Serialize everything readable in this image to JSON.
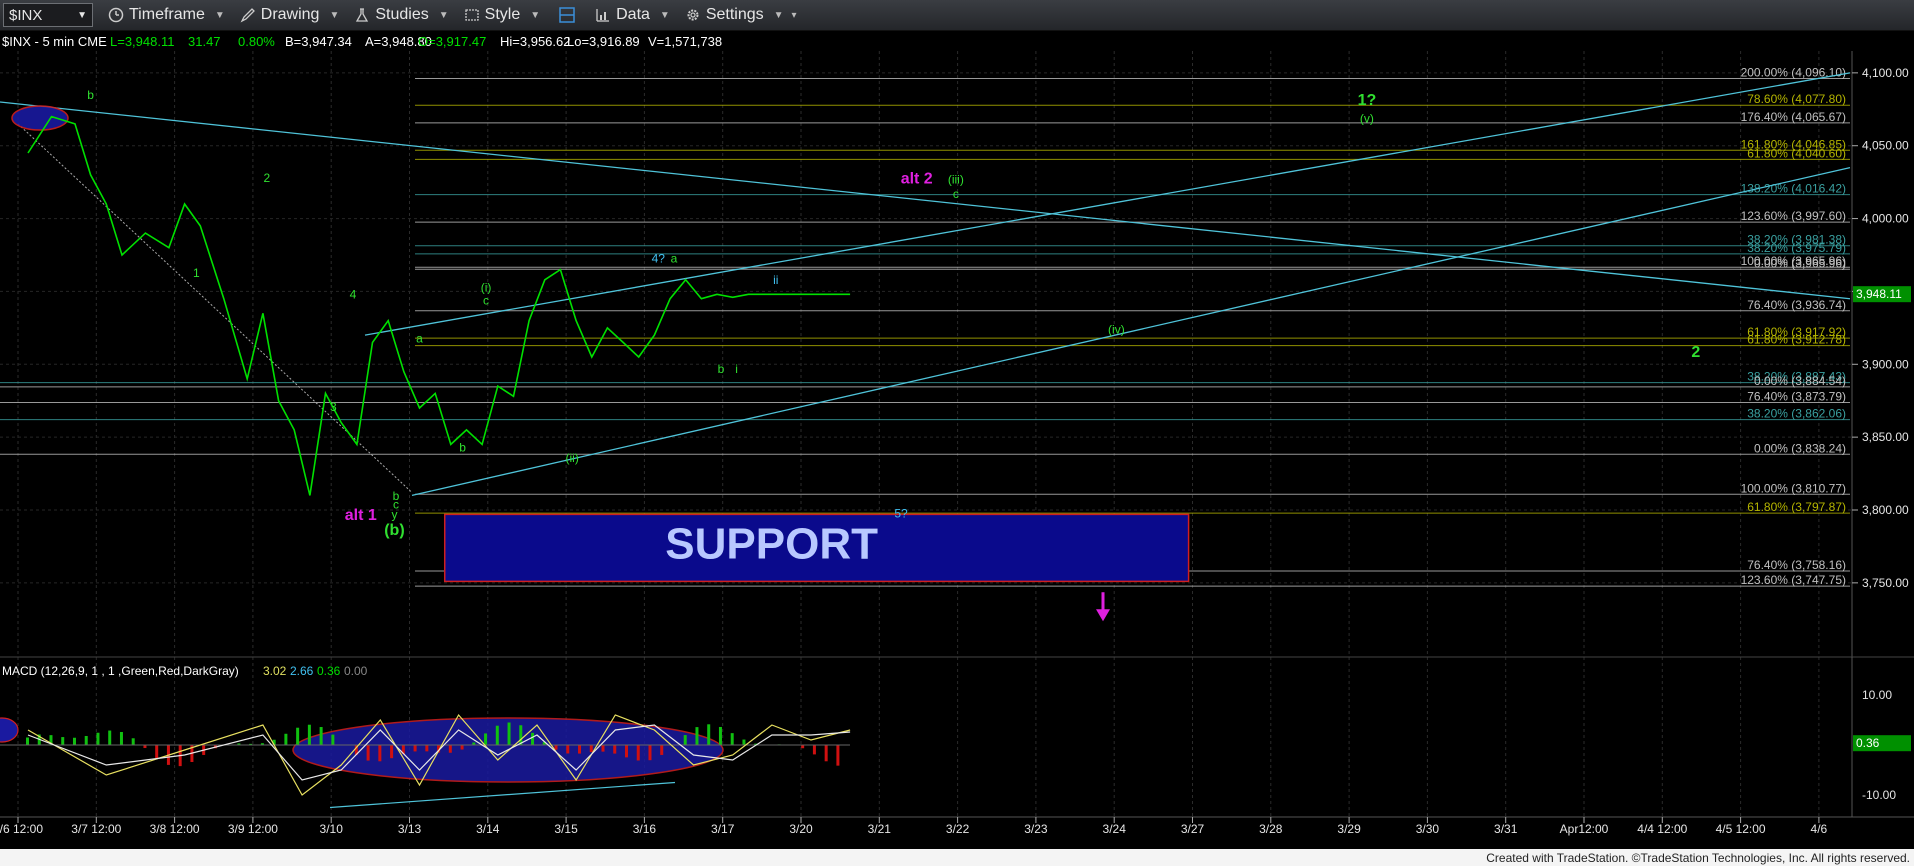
{
  "toolbar": {
    "symbol": "$INX",
    "timeframe": "Timeframe",
    "drawing": "Drawing",
    "studies": "Studies",
    "style": "Style",
    "data": "Data",
    "settings": "Settings"
  },
  "header": {
    "symbol_info": "$INX - 5 min  CME",
    "last": "L=3,948.11",
    "net": "31.47",
    "pct": "0.80%",
    "bid": "B=3,947.34",
    "ask": "A=3,948.80",
    "open": "O=3,917.47",
    "high": "Hi=3,956.62",
    "low": "Lo=3,916.89",
    "volume": "V=1,571,738"
  },
  "colors": {
    "price": "#00e000",
    "grid": "#2a2a2a",
    "fib_gray": "#c0c0c0",
    "fib_olive": "#b5b500",
    "fib_teal": "#3aa0a0",
    "trendline": "#4fc3d9",
    "magenta": "#e020e0",
    "support_fill": "#0a0a8c",
    "support_border": "#d02020",
    "last_price_bg": "#009000"
  },
  "chart_data": [
    {
      "type": "line",
      "title": "",
      "xlabel": "",
      "ylabel": "",
      "x_ticks": [
        "3/6 12:00",
        "3/7 12:00",
        "3/8 12:00",
        "3/9 12:00",
        "3/10",
        "3/13",
        "3/14",
        "3/15",
        "3/16",
        "3/17",
        "3/20",
        "3/21",
        "3/22",
        "3/23",
        "3/24",
        "3/27",
        "3/28",
        "3/29",
        "3/30",
        "3/31",
        "Apr12:00",
        "4/4 12:00",
        "4/5 12:00",
        "4/6"
      ],
      "ylim": [
        3730,
        4115
      ],
      "y_ticks": [
        3750,
        3800,
        3850,
        3900,
        3950,
        4000,
        4050,
        4100
      ],
      "y_tick_labels": [
        "3,750.00",
        "3,800.00",
        "3,850.00",
        "3,900.00",
        "3,950.00",
        "4,000.00",
        "4,050.00",
        "4,100.00"
      ],
      "last_price_label": "3,948.11",
      "series": [
        {
          "x": [
            0,
            0.3,
            0.6,
            0.8,
            1.0,
            1.2,
            1.5,
            1.8,
            2.0,
            2.2,
            2.5,
            2.8,
            3.0,
            3.2,
            3.4,
            3.6,
            3.8,
            4.0,
            4.2,
            4.4,
            4.6,
            4.8,
            5.0,
            5.2,
            5.4,
            5.6,
            5.8,
            6.0,
            6.2,
            6.4,
            6.6,
            6.8,
            7.0,
            7.2,
            7.4,
            7.6,
            7.8,
            8.0,
            8.2,
            8.4,
            8.6,
            8.8,
            9.0,
            9.2,
            9.4,
            9.6,
            9.8,
            10.0,
            10.2,
            10.4,
            10.5
          ],
          "y": [
            4045,
            4070,
            4065,
            4030,
            4010,
            3975,
            3990,
            3980,
            4010,
            3995,
            3945,
            3890,
            3935,
            3875,
            3855,
            3810,
            3880,
            3860,
            3845,
            3915,
            3930,
            3895,
            3870,
            3880,
            3845,
            3855,
            3845,
            3885,
            3878,
            3930,
            3958,
            3965,
            3930,
            3905,
            3925,
            3915,
            3905,
            3920,
            3945,
            3958,
            3945,
            3948,
            3946,
            3948,
            3948,
            3948,
            3948,
            3948,
            3948,
            3948,
            3948
          ]
        }
      ],
      "fib_levels": [
        {
          "label": "200.00% (4,096.10)",
          "value": 4096.1,
          "color": "gray"
        },
        {
          "label": "78.60% (4,077.80)",
          "value": 4077.8,
          "color": "olive"
        },
        {
          "label": "176.40% (4,065.67)",
          "value": 4065.67,
          "color": "gray"
        },
        {
          "label": "161.80% (4,046.85)",
          "value": 4046.85,
          "color": "olive"
        },
        {
          "label": "61.80% (4,040.60)",
          "value": 4040.6,
          "color": "olive"
        },
        {
          "label": "138.20% (4,016.42)",
          "value": 4016.42,
          "color": "teal"
        },
        {
          "label": "123.60% (3,997.60)",
          "value": 3997.6,
          "color": "gray"
        },
        {
          "label": "38.20% (3,981.38)",
          "value": 3981.38,
          "color": "teal"
        },
        {
          "label": "38.20% (3,975.79)",
          "value": 3975.79,
          "color": "teal"
        },
        {
          "label": "100.00% (3,965.96)",
          "value": 3966.6,
          "color": "gray"
        },
        {
          "label": "0.00% (3,965.96)",
          "value": 3965.2,
          "color": "gray"
        },
        {
          "label": "76.40% (3,936.74)",
          "value": 3936.74,
          "color": "gray"
        },
        {
          "label": "61.80% (3,917.92)",
          "value": 3917.92,
          "color": "olive"
        },
        {
          "label": "61.80% (3,912.78)",
          "value": 3912.78,
          "color": "olive"
        },
        {
          "label": "38.20% (3,887.43)",
          "value": 3887.43,
          "color": "teal"
        },
        {
          "label": "0.00% (3,884.54)",
          "value": 3884.54,
          "color": "gray"
        },
        {
          "label": "76.40% (3,873.79)",
          "value": 3873.79,
          "color": "gray"
        },
        {
          "label": "38.20% (3,862.06)",
          "value": 3862.06,
          "color": "teal"
        },
        {
          "label": "0.00% (3,838.24)",
          "value": 3838.24,
          "color": "gray"
        },
        {
          "label": "100.00% (3,810.77)",
          "value": 3810.77,
          "color": "gray"
        },
        {
          "label": "61.80% (3,797.87)",
          "value": 3797.87,
          "color": "olive"
        },
        {
          "label": "76.40% (3,758.16)",
          "value": 3758.16,
          "color": "gray"
        },
        {
          "label": "123.60% (3,747.75)",
          "value": 3747.75,
          "color": "gray"
        }
      ],
      "annotations": [
        {
          "text": "b",
          "x": 0.8,
          "y": 4082,
          "color": "green"
        },
        {
          "text": "2",
          "x": 3.05,
          "y": 4025,
          "color": "green"
        },
        {
          "text": "1",
          "x": 2.15,
          "y": 3960,
          "color": "green"
        },
        {
          "text": "4",
          "x": 4.15,
          "y": 3945,
          "color": "green"
        },
        {
          "text": "3",
          "x": 3.9,
          "y": 3868,
          "color": "green"
        },
        {
          "text": "a",
          "x": 5.0,
          "y": 3915,
          "color": "green"
        },
        {
          "text": "b",
          "x": 5.55,
          "y": 3840,
          "color": "green"
        },
        {
          "text": "(i)",
          "x": 5.85,
          "y": 3950,
          "color": "green"
        },
        {
          "text": "c",
          "x": 5.85,
          "y": 3941,
          "color": "green"
        },
        {
          "text": "(ii)",
          "x": 6.95,
          "y": 3833,
          "color": "green"
        },
        {
          "text": "4?",
          "x": 8.05,
          "y": 3970,
          "color": "teal"
        },
        {
          "text": "a",
          "x": 8.25,
          "y": 3970,
          "color": "green"
        },
        {
          "text": "b",
          "x": 8.85,
          "y": 3894,
          "color": "green"
        },
        {
          "text": "i",
          "x": 9.05,
          "y": 3894,
          "color": "green"
        },
        {
          "text": "ii",
          "x": 9.55,
          "y": 3955,
          "color": "teal"
        },
        {
          "text": "b",
          "x": 4.7,
          "y": 3807,
          "color": "green"
        },
        {
          "text": "c",
          "x": 4.7,
          "y": 3801,
          "color": "green"
        },
        {
          "text": "y",
          "x": 4.68,
          "y": 3794,
          "color": "green"
        },
        {
          "text": "(b)",
          "x": 4.68,
          "y": 3783,
          "color": "green"
        },
        {
          "text": "alt 1",
          "x": 4.25,
          "y": 3793,
          "color": "magenta"
        },
        {
          "text": "5?",
          "x": 11.15,
          "y": 3795,
          "color": "teal"
        },
        {
          "text": "alt 2",
          "x": 11.35,
          "y": 4024,
          "color": "magenta"
        },
        {
          "text": "(iii)",
          "x": 11.85,
          "y": 4024,
          "color": "green"
        },
        {
          "text": "c",
          "x": 11.85,
          "y": 4014,
          "color": "green"
        },
        {
          "text": "(iv)",
          "x": 13.9,
          "y": 3921,
          "color": "green"
        },
        {
          "text": "1?",
          "x": 17.1,
          "y": 4078,
          "color": "green"
        },
        {
          "text": "(v)",
          "x": 17.1,
          "y": 4066,
          "color": "green"
        },
        {
          "text": "2",
          "x": 21.3,
          "y": 3905,
          "color": "green"
        }
      ],
      "support_box": {
        "label": "SUPPORT",
        "x0": 5.45,
        "x1": 14.95,
        "y0": 3751,
        "y1": 3797
      }
    },
    {
      "type": "line",
      "title": "MACD (12,26,9, 1 , 1 ,Green,Red,DarkGray)",
      "values_shown": [
        "3.02",
        "2.66",
        "0.36",
        "0.00"
      ],
      "ylim": [
        -14,
        16
      ],
      "y_ticks": [
        10,
        -10
      ],
      "y_tick_labels": [
        "10.00",
        "-10.00"
      ],
      "last_value_label": "0.36",
      "series": [
        {
          "name": "MACD",
          "x": [
            0,
            1,
            2,
            3,
            3.5,
            4,
            4.5,
            5,
            5.5,
            6,
            6.5,
            7,
            7.5,
            8,
            8.5,
            9,
            9.5,
            10,
            10.5
          ],
          "y": [
            3,
            -6,
            -1,
            4,
            -10,
            -4,
            5,
            -8,
            6,
            -3,
            4,
            -7,
            6,
            3,
            -4,
            -2,
            4,
            1,
            3
          ]
        },
        {
          "name": "Signal",
          "x": [
            0,
            1,
            2,
            3,
            3.5,
            4,
            4.5,
            5,
            5.5,
            6,
            6.5,
            7,
            7.5,
            8,
            8.5,
            9,
            9.5,
            10,
            10.5
          ],
          "y": [
            2,
            -4,
            -2,
            2,
            -7,
            -5,
            3,
            -5,
            3,
            -2,
            2,
            -5,
            3,
            4,
            -2,
            -3,
            2,
            2,
            2.6
          ]
        }
      ]
    }
  ],
  "footer": {
    "text": "Created with TradeStation. ©TradeStation Technologies, Inc. All rights reserved."
  }
}
